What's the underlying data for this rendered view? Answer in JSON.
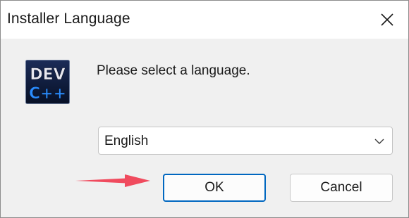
{
  "window": {
    "title": "Installer Language"
  },
  "icons": {
    "close": "close-icon",
    "app": "dev-cpp-icon",
    "dropdown": "chevron-down-icon",
    "annotation": "red-arrow-icon"
  },
  "app_icon": {
    "line1": "DEV",
    "line2": "C++"
  },
  "dialog": {
    "prompt": "Please select a language.",
    "language_select": {
      "selected": "English"
    },
    "ok_label": "OK",
    "cancel_label": "Cancel"
  },
  "colors": {
    "accent": "#0067c0",
    "annotation_arrow": "#f04b5e",
    "icon_bg": "#0a1a3a",
    "icon_text_top": "#e8e8f0",
    "icon_text_bottom": "#2a8cff"
  }
}
